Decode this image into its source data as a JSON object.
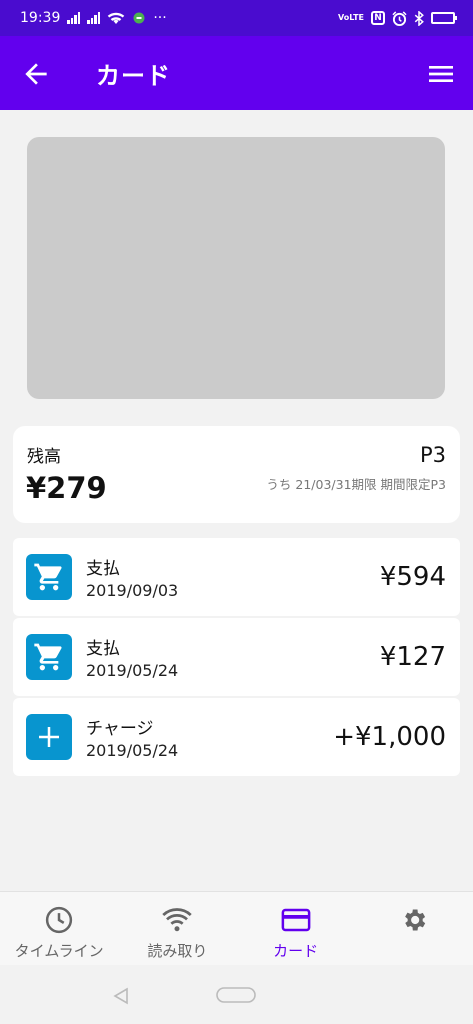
{
  "status_bar": {
    "time": "19:39",
    "left_icons": [
      "signal-icon",
      "signal-icon",
      "wifi-icon",
      "message-icon",
      "more-icon"
    ],
    "more": "···",
    "volte": "VoLTE",
    "nfc": "N",
    "right_icons": [
      "volte-icon",
      "nfc-icon",
      "alarm-icon",
      "bluetooth-icon",
      "battery-icon"
    ]
  },
  "app_bar": {
    "title": "カード",
    "back_icon": "arrow-left-icon",
    "menu_icon": "hamburger-menu-icon",
    "background": "#6200ee"
  },
  "card_image": {
    "placeholder_color": "#cbcbcb"
  },
  "balance": {
    "label": "残高",
    "amount": "¥279",
    "points": "P3",
    "points_note": "うち 21/03/31期限 期間限定P3"
  },
  "transactions": [
    {
      "icon": "shopping-cart-icon",
      "type": "支払",
      "date": "2019/09/03",
      "amount": "¥594"
    },
    {
      "icon": "shopping-cart-icon",
      "type": "支払",
      "date": "2019/05/24",
      "amount": "¥127"
    },
    {
      "icon": "plus-icon",
      "type": "チャージ",
      "date": "2019/05/24",
      "amount": "+¥1,000"
    }
  ],
  "bottom_nav": [
    {
      "icon": "clock-icon",
      "label": "タイムライン",
      "active": false
    },
    {
      "icon": "wifi-icon",
      "label": "読み取り",
      "active": false
    },
    {
      "icon": "credit-card-icon",
      "label": "カード",
      "active": true
    },
    {
      "icon": "gear-icon",
      "label": "",
      "active": false
    }
  ],
  "colors": {
    "status_bar": "#4a0ccf",
    "accent": "#6200ee",
    "transaction_icon": "#0895cf",
    "inactive_icon": "#666666"
  }
}
